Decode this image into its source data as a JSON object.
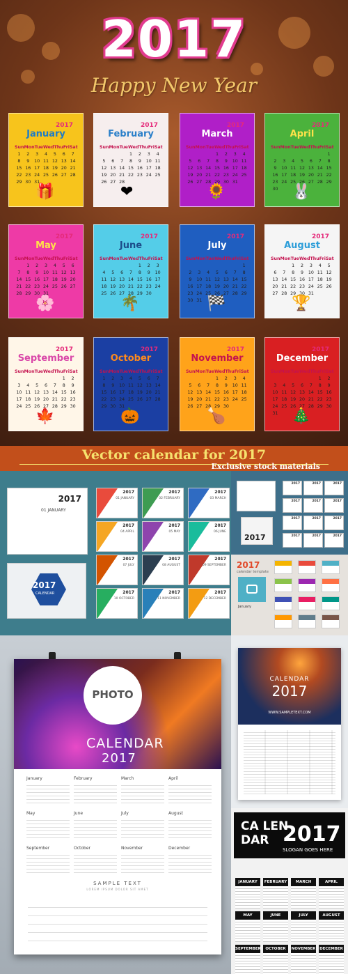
{
  "banner": {
    "year": "2017",
    "greeting": "Happy New Year",
    "weekdays": [
      "Sun",
      "Mon",
      "Tue",
      "Wed",
      "Thu",
      "Fri",
      "Sat"
    ],
    "months": [
      {
        "name": "January",
        "year": "2017",
        "bg": "#f7c41c",
        "color": "#1e7bc6"
      },
      {
        "name": "February",
        "year": "2017",
        "bg": "#f6eeee",
        "color": "#2a7fc9"
      },
      {
        "name": "March",
        "year": "2017",
        "bg": "#b01fc8",
        "color": "#ffffff"
      },
      {
        "name": "April",
        "year": "2017",
        "bg": "#4bb23c",
        "color": "#ffe24a"
      },
      {
        "name": "May",
        "year": "2017",
        "bg": "#ee3aa6",
        "color": "#ffe24a"
      },
      {
        "name": "June",
        "year": "2017",
        "bg": "#54cde8",
        "color": "#1c4d8a"
      },
      {
        "name": "July",
        "year": "2017",
        "bg": "#1f5ec0",
        "color": "#ffffff"
      },
      {
        "name": "August",
        "year": "2017",
        "bg": "#f5f5f5",
        "color": "#2e9ed9"
      },
      {
        "name": "September",
        "year": "2017",
        "bg": "#fff6e8",
        "color": "#d946a8"
      },
      {
        "name": "October",
        "year": "2017",
        "bg": "#1b3fa3",
        "color": "#ff8a1c"
      },
      {
        "name": "November",
        "year": "2017",
        "bg": "#ffa31a",
        "color": "#c4124f"
      },
      {
        "name": "December",
        "year": "2017",
        "bg": "#d91f22",
        "color": "#ffffff"
      }
    ],
    "caption": "Vector calendar for 2017",
    "subcaption": "Exclusive stock materials"
  },
  "samples": {
    "desk_year": "2017",
    "desk_date": "01 JANUARY",
    "brochure_year": "2017",
    "brochure_caption": "CALENDAR",
    "tile_year": "2017",
    "tile_months": [
      "01 JANUARY",
      "02 FEBRUARY",
      "03 MARCH",
      "04 APRIL",
      "05 MAY",
      "06 JUNE",
      "07 JULY",
      "08 AUGUST",
      "09 SEPTEMBER",
      "10 OCTOBER",
      "11 NOVEMBER",
      "12 DECEMBER"
    ],
    "desk2_year": "2017",
    "mini_year": "2017",
    "template_year": "2017",
    "template_caption": "calendar template",
    "template_month": "January"
  },
  "poster": {
    "photo": "PHOTO",
    "title": "CALENDAR",
    "year": "2017",
    "months": [
      "January",
      "February",
      "March",
      "April",
      "May",
      "June",
      "July",
      "August",
      "September",
      "October",
      "November",
      "December"
    ],
    "sample_text": "SAMPLE TEXT",
    "lorem": "LOREM IPSUM DOLOR SIT AMET"
  },
  "side_poster": {
    "title": "CALENDAR",
    "year": "2017",
    "site": "WWW.SAMPLETEXT.COM"
  },
  "dark_calendar": {
    "word_line1": "CA LEN",
    "word_line2": "DAR",
    "year": "2017",
    "slogan": "SLOGAN GOES HERE",
    "months": [
      "JANUARY",
      "FEBRUARY",
      "MARCH",
      "APRIL",
      "MAY",
      "JUNE",
      "JULY",
      "AUGUST",
      "SEPTEMBER",
      "OCTOBER",
      "NOVEMBER",
      "DECEMBER"
    ]
  }
}
